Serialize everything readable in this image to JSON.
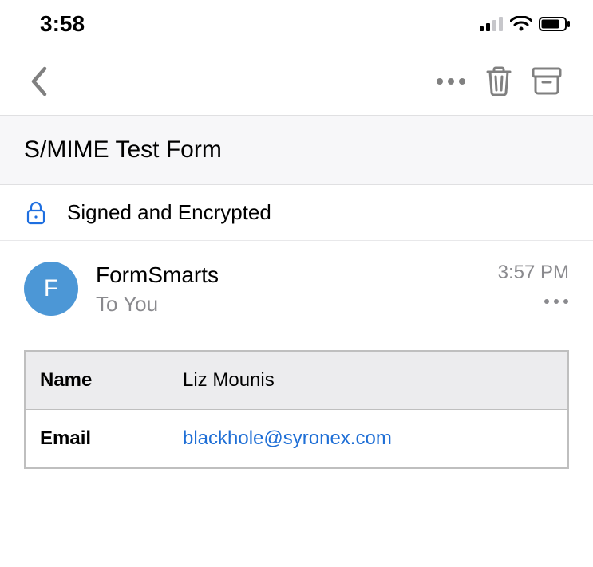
{
  "status": {
    "time": "3:58"
  },
  "subject": "S/MIME Test Form",
  "security": {
    "label": "Signed and Encrypted"
  },
  "sender": {
    "name": "FormSmarts",
    "initial": "F",
    "recipient": "To You",
    "time": "3:57 PM"
  },
  "content": {
    "rows": [
      {
        "label": "Name",
        "value": "Liz Mounis"
      },
      {
        "label": "Email",
        "value": "blackhole@syronex.com"
      }
    ]
  }
}
